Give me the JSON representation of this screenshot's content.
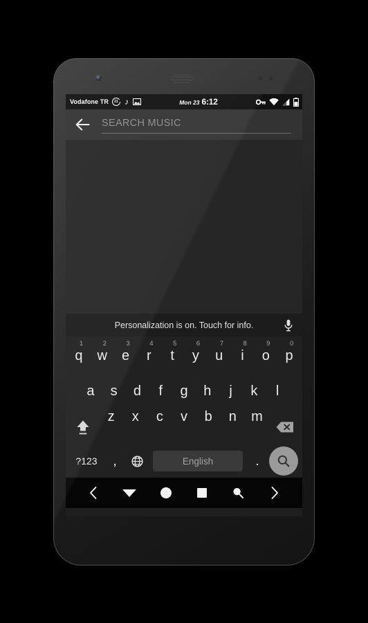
{
  "device": {
    "hardware": {
      "front_camera": "front-camera",
      "earpiece": "earpiece-speaker",
      "sensor_left": "proximity-sensor",
      "sensor_right": "ambient-light-sensor"
    }
  },
  "status_bar": {
    "carrier": "Vodafone TR",
    "icons_left": [
      {
        "name": "alarm-badge-icon",
        "label": "21"
      },
      {
        "name": "music-note-icon",
        "glyph": "♪"
      },
      {
        "name": "image-icon",
        "glyph": "▣"
      }
    ],
    "date": "Mon 23",
    "time": "6:12",
    "icons_right": [
      {
        "name": "vpn-key-icon"
      },
      {
        "name": "wifi-icon"
      },
      {
        "name": "signal-icon"
      },
      {
        "name": "battery-icon"
      }
    ]
  },
  "action_bar": {
    "back_label": "Back",
    "search_value": "",
    "search_placeholder": "SEARCH MUSIC"
  },
  "content": {
    "empty": ""
  },
  "keyboard": {
    "suggestion": "Personalization is on. Touch for info.",
    "mic_label": "Voice input",
    "row1": [
      {
        "char": "q",
        "hint": "1"
      },
      {
        "char": "w",
        "hint": "2"
      },
      {
        "char": "e",
        "hint": "3"
      },
      {
        "char": "r",
        "hint": "4"
      },
      {
        "char": "t",
        "hint": "5"
      },
      {
        "char": "y",
        "hint": "6"
      },
      {
        "char": "u",
        "hint": "7"
      },
      {
        "char": "i",
        "hint": "8"
      },
      {
        "char": "o",
        "hint": "9"
      },
      {
        "char": "p",
        "hint": "0"
      }
    ],
    "row2": [
      {
        "char": "a"
      },
      {
        "char": "s"
      },
      {
        "char": "d"
      },
      {
        "char": "f"
      },
      {
        "char": "g"
      },
      {
        "char": "h"
      },
      {
        "char": "j"
      },
      {
        "char": "k"
      },
      {
        "char": "l"
      }
    ],
    "row3": [
      {
        "char": "z"
      },
      {
        "char": "x"
      },
      {
        "char": "c"
      },
      {
        "char": "v"
      },
      {
        "char": "b"
      },
      {
        "char": "n"
      },
      {
        "char": "m"
      }
    ],
    "shift_label": "Shift",
    "backspace_label": "Backspace",
    "symbols_label": "?123",
    "comma_label": ",",
    "globe_label": "Change language",
    "space_label": "English",
    "period_label": ".",
    "enter_label": "Search"
  },
  "nav_bar": {
    "buttons": [
      {
        "name": "nav-prev-icon",
        "label": "Previous"
      },
      {
        "name": "nav-hide-keyboard-icon",
        "label": "Hide keyboard"
      },
      {
        "name": "nav-home-icon",
        "label": "Home"
      },
      {
        "name": "nav-recents-icon",
        "label": "Recents"
      },
      {
        "name": "nav-search-icon",
        "label": "Search"
      },
      {
        "name": "nav-next-icon",
        "label": "Next"
      }
    ]
  },
  "colors": {
    "screen_bg": "#262626",
    "action_bar_bg": "#333333",
    "keyboard_bg": "#212121",
    "status_bar_bg": "#111111",
    "nav_bar_bg": "#050505",
    "key_text": "#ededed",
    "enter_key_bg": "#9a9a9a",
    "space_key_bg": "#3a3a3a",
    "placeholder": "#8e8e8e"
  }
}
